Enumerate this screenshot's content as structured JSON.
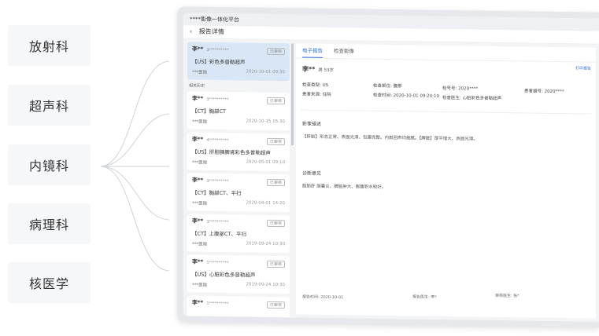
{
  "departments": [
    "放射科",
    "超声科",
    "内镜科",
    "病理科",
    "核医学"
  ],
  "app": {
    "title": "****影像一体化平台",
    "page_title": "报告详情"
  },
  "list": {
    "history_label": "相关历史",
    "cards": [
      {
        "name": "李**",
        "mask": "3**********",
        "badge": "已审核",
        "exam": "【US】彩色多普勒超声",
        "hospital": "***医院",
        "date": "2020-10-01 09:30"
      },
      {
        "name": "李**",
        "mask": "3**********",
        "badge": "已审核",
        "exam": "【CT】胸部CT",
        "hospital": "***医院",
        "date": "2020-10-15 15:30"
      },
      {
        "name": "李**",
        "mask": "4**********",
        "badge": "已审核",
        "exam": "【US】肝胆胰脾肾彩色多普勒超声",
        "hospital": "***医院",
        "date": "2020-05-01 09:10"
      },
      {
        "name": "李**",
        "mask": "3**********",
        "badge": "已审核",
        "exam": "【CT】胸部CT、平扫",
        "hospital": "***医院",
        "date": "2020-04-01 14:20"
      },
      {
        "name": "李**",
        "mask": "3**********",
        "badge": "已审核",
        "exam": "【CT】上腹部CT、平扫",
        "hospital": "***医院",
        "date": "2019-09-24 10:30"
      },
      {
        "name": "李**",
        "mask": "1**********",
        "badge": "已审核",
        "exam": "【US】心脏彩色多普勒超声",
        "hospital": "***医院",
        "date": "2019-09-24 10:30"
      },
      {
        "name": "李**",
        "mask": "1**********",
        "badge": "已审核",
        "exam": "",
        "hospital": "",
        "date": ""
      }
    ]
  },
  "detail": {
    "tab_report": "电子报告",
    "tab_image": "检查影像",
    "print": "打印报告",
    "patient_name": "李**",
    "patient_sub": "男 53岁",
    "type_label": "检查类型: US",
    "dept_label": "患者来源: 住院",
    "part_label": "检查部位: 腹部",
    "time_label": "检查时间: 2020-10-01 09:20:10",
    "no_label": "检号号: 2020****",
    "doctor_label": "检查医生: 心脏彩色多普勒超声",
    "id_label": "患者编号: 2020****",
    "finding_title": "影像描述",
    "finding_text": "【肝脏】形态正常、表面光滑、包膜完整。内部回声均细腻。【脾脏】厚平增大、表面光滑。",
    "impression_title": "诊断意见",
    "impression_text": "脂肪肝 胆囊炎、脾脏肿大、膨腹积水较好。",
    "footer_date": "报告时间: 2020-10-01",
    "footer_reporter": "报告医生: 李*",
    "footer_reviewer": "审核医生: 张*"
  }
}
